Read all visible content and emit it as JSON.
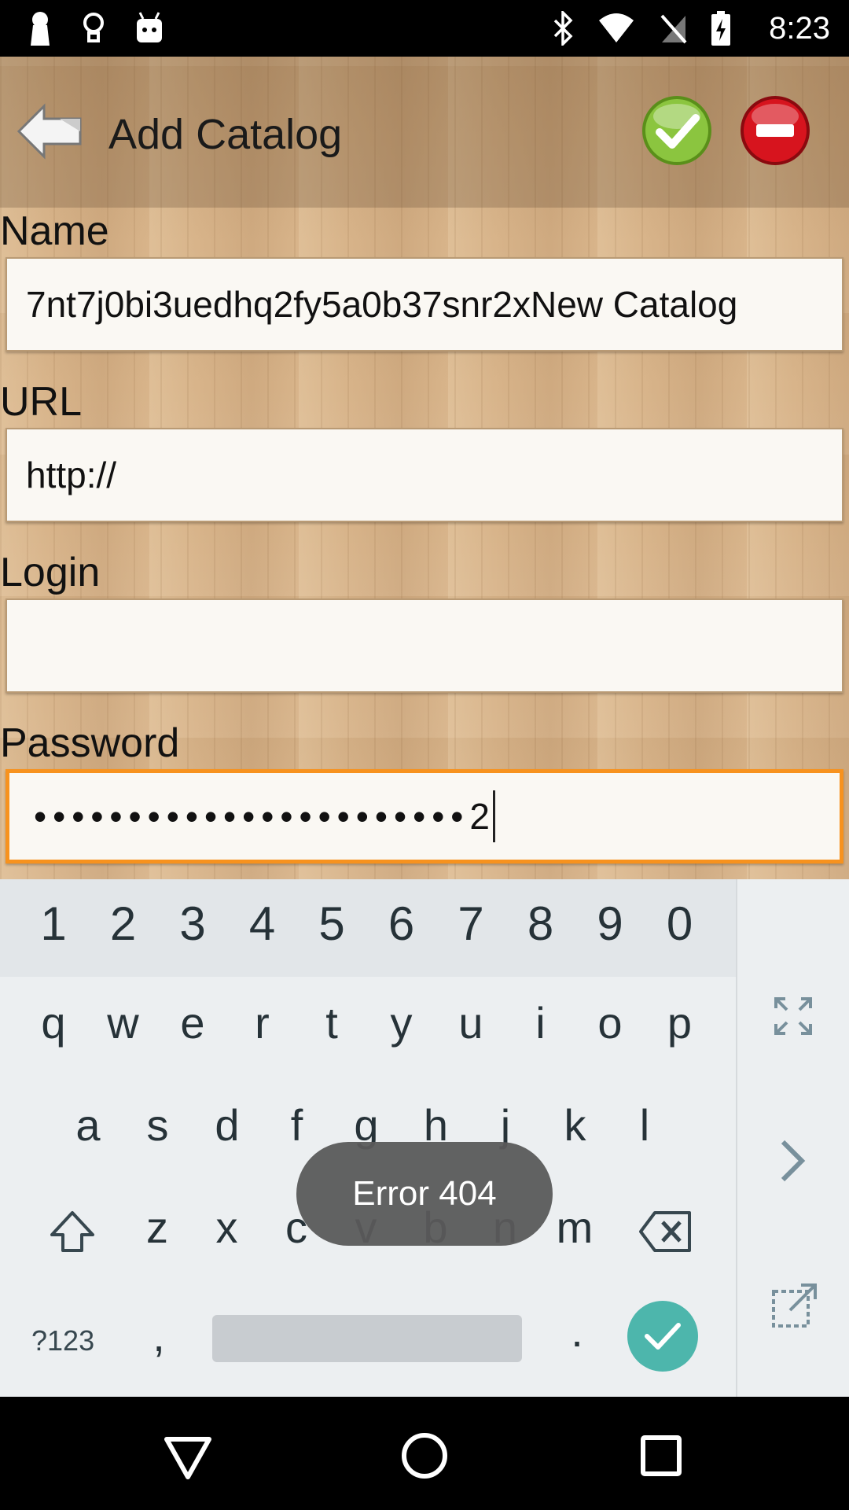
{
  "status_bar": {
    "time": "8:23",
    "left_icons": [
      "keyhole-icon",
      "lightbulb-icon",
      "android-icon"
    ],
    "right_icons": [
      "bluetooth-icon",
      "wifi-icon",
      "no-sim-icon",
      "battery-charging-icon"
    ]
  },
  "action_bar": {
    "title": "Add Catalog",
    "back_icon": "back-arrow-icon",
    "confirm_icon": "green-check-icon",
    "cancel_icon": "red-minus-icon"
  },
  "form": {
    "name_label": "Name",
    "name_value": "7nt7j0bi3uedhq2fy5a0b37snr2xNew Catalog",
    "url_label": "URL",
    "url_value": "http://",
    "login_label": "Login",
    "login_value": "",
    "password_label": "Password",
    "password_masked": "•••••••••••••••••••••••",
    "password_last_char": "2"
  },
  "keyboard": {
    "number_row": [
      "1",
      "2",
      "3",
      "4",
      "5",
      "6",
      "7",
      "8",
      "9",
      "0"
    ],
    "row1": [
      "q",
      "w",
      "e",
      "r",
      "t",
      "y",
      "u",
      "i",
      "o",
      "p"
    ],
    "row2": [
      "a",
      "s",
      "d",
      "f",
      "g",
      "h",
      "j",
      "k",
      "l"
    ],
    "row3": [
      "z",
      "x",
      "c",
      "v",
      "b",
      "n",
      "m"
    ],
    "symbols_label": "?123",
    "comma": ",",
    "period": ".",
    "side_icons": [
      "expand-icon",
      "chevron-right-icon",
      "popout-icon"
    ]
  },
  "toast": {
    "text": "Error 404"
  },
  "colors": {
    "focus_border": "#f7921e",
    "enter_key": "#4db6ac",
    "confirm_green": "#8bc53f",
    "cancel_red": "#d7141e"
  },
  "nav_bar": {
    "icons": [
      "back-triangle-icon",
      "home-circle-icon",
      "recents-square-icon"
    ]
  }
}
